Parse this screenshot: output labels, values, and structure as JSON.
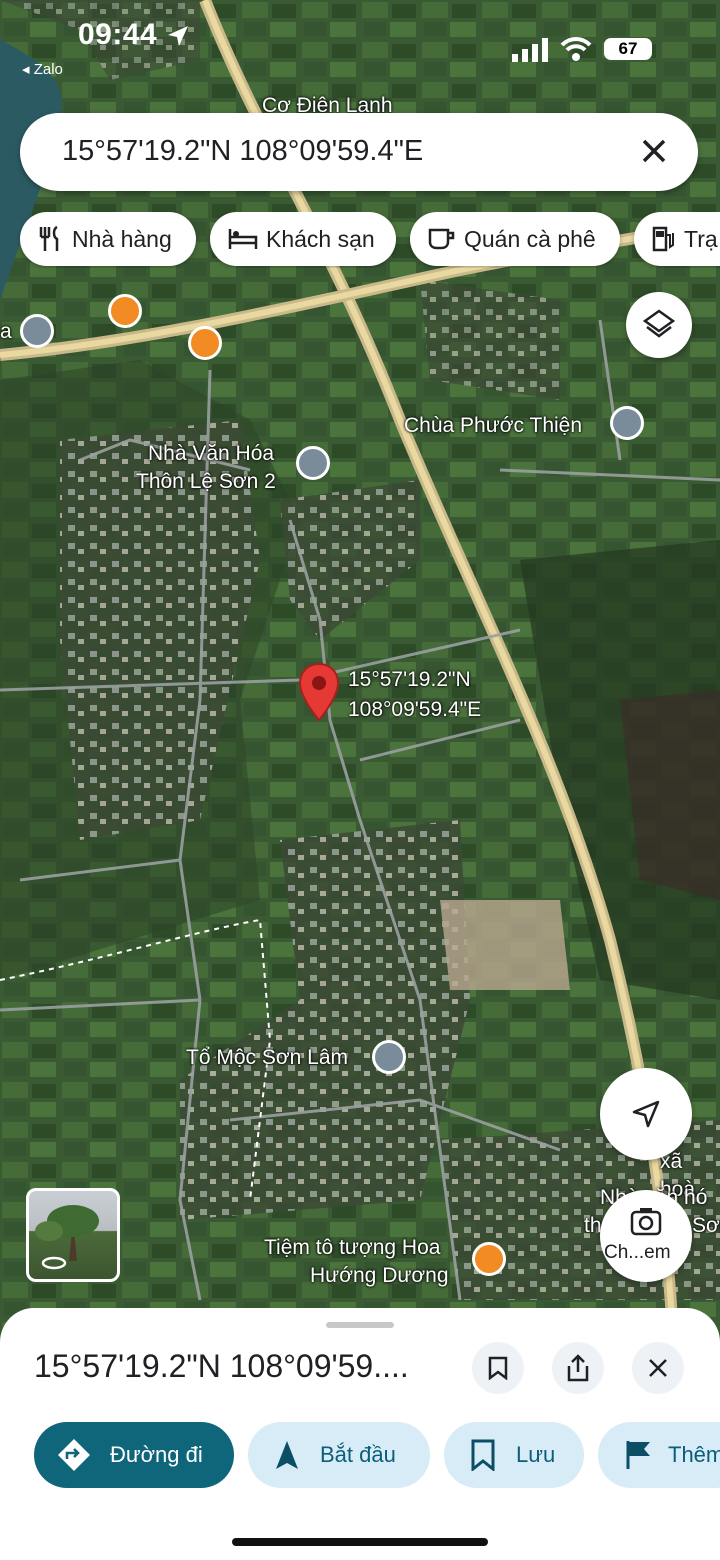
{
  "status": {
    "time": "09:44",
    "back_app": "◂ Zalo",
    "battery": "67"
  },
  "search": {
    "query": "15°57'19.2\"N 108°09'59.4\"E"
  },
  "chips": [
    {
      "label": "Nhà hàng",
      "icon": "restaurant-icon"
    },
    {
      "label": "Khách sạn",
      "icon": "hotel-icon"
    },
    {
      "label": "Quán cà phê",
      "icon": "coffee-icon"
    },
    {
      "label": "Trạ",
      "icon": "gas-station-icon"
    }
  ],
  "map": {
    "labels": {
      "co_dien_lanh": "Cơ Điện Lạnh",
      "chua": "Chùa Phước Thiện",
      "nha_van_hoa_1": "Nhà Văn Hóa",
      "nha_van_hoa_2": "Thôn Lệ Sơn 2",
      "pin_lat": "15°57'19.2\"N",
      "pin_lng": "108°09'59.4\"E",
      "to_moc": "Tổ Mộc Sơn Lâm",
      "tiem_1": "Tiệm tô tượng Hoa",
      "tiem_2": "Hướng Dương",
      "xa_hoa": "xã hoà",
      "nha_van_hoa_right_1": "Nhà văn hó",
      "nha_van_hoa_right_2": "th",
      "nha_van_hoa_right_3": "Sơn",
      "left_edge": "a",
      "camera_label": "Ch...em"
    }
  },
  "sheet": {
    "title": "15°57'19.2\"N 108°09'59....",
    "actions": [
      {
        "label": "Đường đi",
        "icon": "directions-icon"
      },
      {
        "label": "Bắt đầu",
        "icon": "navigation-arrow-icon"
      },
      {
        "label": "Lưu",
        "icon": "bookmark-icon"
      },
      {
        "label": "Thêm",
        "icon": "flag-icon"
      }
    ]
  },
  "colors": {
    "accent": "#0f6579",
    "pin": "#e53935",
    "chip_bg": "#ffffff",
    "action_bg": "#d7ecf7"
  }
}
